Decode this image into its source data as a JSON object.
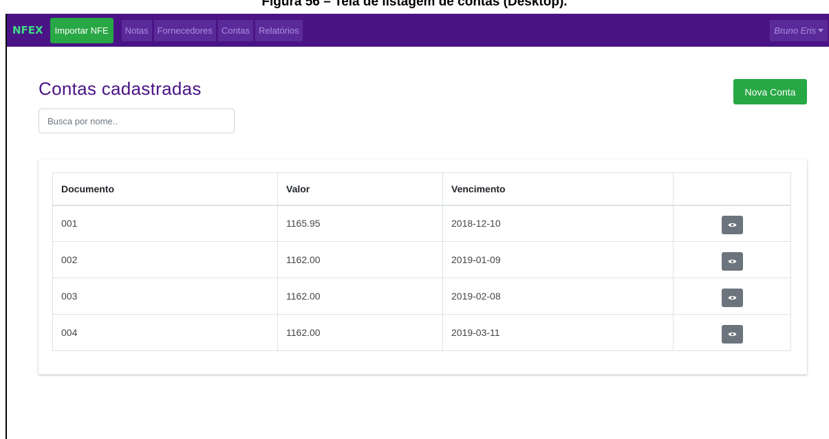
{
  "caption": "Figura 56 – Tela de listagem de contas (Desktop).",
  "navbar": {
    "brand": "NFEX",
    "import_label": "Importar NFE",
    "links": [
      "Notas",
      "Fornecedores",
      "Contas",
      "Relatórios"
    ],
    "user": "Bruno Eris"
  },
  "main": {
    "title": "Contas cadastradas",
    "new_button": "Nova Conta",
    "search_placeholder": "Busca por nome.."
  },
  "table": {
    "headers": [
      "Documento",
      "Valor",
      "Vencimento",
      ""
    ],
    "rows": [
      {
        "documento": "001",
        "valor": "1165.95",
        "vencimento": "2018-12-10"
      },
      {
        "documento": "002",
        "valor": "1162.00",
        "vencimento": "2019-01-09"
      },
      {
        "documento": "003",
        "valor": "1162.00",
        "vencimento": "2019-02-08"
      },
      {
        "documento": "004",
        "valor": "1162.00",
        "vencimento": "2019-03-11"
      }
    ]
  },
  "icons": {
    "view": "eye-icon",
    "user_caret": "caret-down-icon"
  },
  "colors": {
    "navbar": "#4a1486",
    "brand": "#3ddc84",
    "success": "#28a745",
    "title": "#4a1486",
    "view_button": "#6c757d"
  }
}
